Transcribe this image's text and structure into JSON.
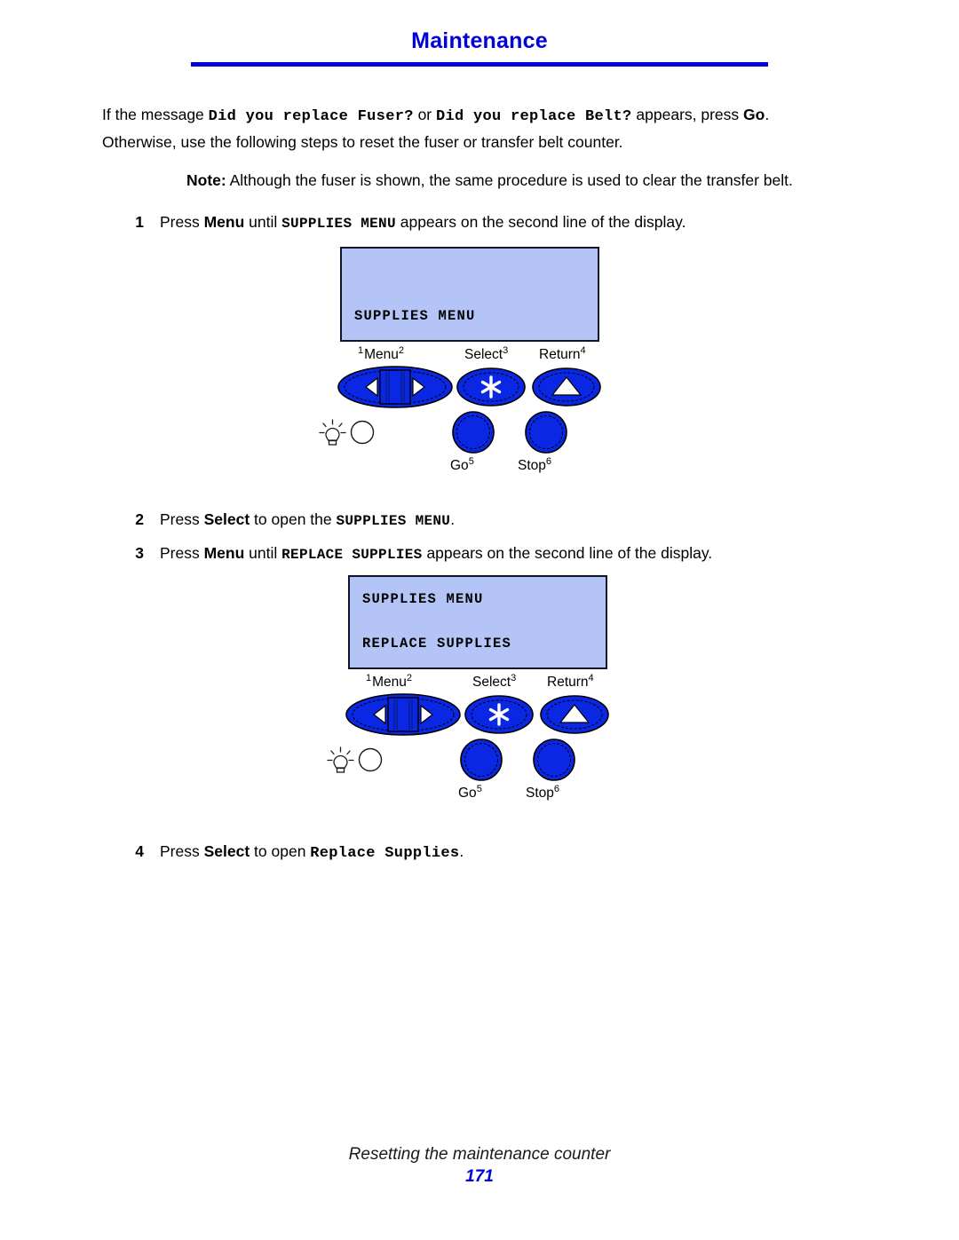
{
  "header": {
    "title": "Maintenance",
    "rule_color": "#0000d8"
  },
  "intro": {
    "part1": "If the message ",
    "msg1": "Did you replace Fuser?",
    "part2": " or ",
    "msg2": "Did you replace Belt?",
    "part3": " appears, press ",
    "go": "Go",
    "part4": ".",
    "line2": "Otherwise, use the following steps to reset the fuser or transfer belt counter."
  },
  "note": {
    "label": "Note:",
    "text": " Although the fuser is shown, the same procedure is used to clear the transfer belt."
  },
  "steps": [
    {
      "number": "1",
      "pre": "Press ",
      "bold1": "Menu",
      "mid": " until ",
      "mono": "SUPPLIES MENU",
      "post": " appears on the second line of the display."
    },
    {
      "number": "2",
      "pre": "Press ",
      "bold1": "Select",
      "mid": " to open the ",
      "mono": "SUPPLIES MENU",
      "post": "."
    },
    {
      "number": "3",
      "pre": "Press ",
      "bold1": "Menu",
      "mid": " until ",
      "mono": "REPLACE SUPPLIES",
      "post": " appears on the second line of the display."
    },
    {
      "number": "4",
      "pre": "Press ",
      "bold1": "Select",
      "mid": " to open ",
      "mono": "Replace Supplies",
      "post": "."
    }
  ],
  "panels": [
    {
      "id": "panel-1",
      "lcd": {
        "line1": "",
        "line2": "SUPPLIES MENU",
        "bg_color": "#b4c4f7"
      },
      "buttons": [
        {
          "name": "menu",
          "label": "Menu",
          "left_num": "1",
          "right_num": "2",
          "icon": "left-right-arrows-icon"
        },
        {
          "name": "select",
          "label": "Select",
          "left_num": "",
          "right_num": "3",
          "icon": "asterisk-icon"
        },
        {
          "name": "return",
          "label": "Return",
          "left_num": "",
          "right_num": "4",
          "icon": "up-triangle-icon"
        },
        {
          "name": "go",
          "label": "Go",
          "left_num": "",
          "right_num": "5",
          "icon": "round-button-icon"
        },
        {
          "name": "stop",
          "label": "Stop",
          "left_num": "",
          "right_num": "6",
          "icon": "round-button-icon"
        }
      ],
      "indicator": {
        "bulb": "lightbulb-icon",
        "led": "led-indicator-icon"
      },
      "button_color": "#0a28e4"
    },
    {
      "id": "panel-2",
      "lcd": {
        "line1": "SUPPLIES MENU",
        "line2": "REPLACE SUPPLIES",
        "bg_color": "#b4c4f7"
      },
      "buttons": [
        {
          "name": "menu",
          "label": "Menu",
          "left_num": "1",
          "right_num": "2",
          "icon": "left-right-arrows-icon"
        },
        {
          "name": "select",
          "label": "Select",
          "left_num": "",
          "right_num": "3",
          "icon": "asterisk-icon"
        },
        {
          "name": "return",
          "label": "Return",
          "left_num": "",
          "right_num": "4",
          "icon": "up-triangle-icon"
        },
        {
          "name": "go",
          "label": "Go",
          "left_num": "",
          "right_num": "5",
          "icon": "round-button-icon"
        },
        {
          "name": "stop",
          "label": "Stop",
          "left_num": "",
          "right_num": "6",
          "icon": "round-button-icon"
        }
      ],
      "indicator": {
        "bulb": "lightbulb-icon",
        "led": "led-indicator-icon"
      },
      "button_color": "#0a28e4"
    }
  ],
  "footer": {
    "text": "Resetting the maintenance counter",
    "page_number": "171"
  }
}
